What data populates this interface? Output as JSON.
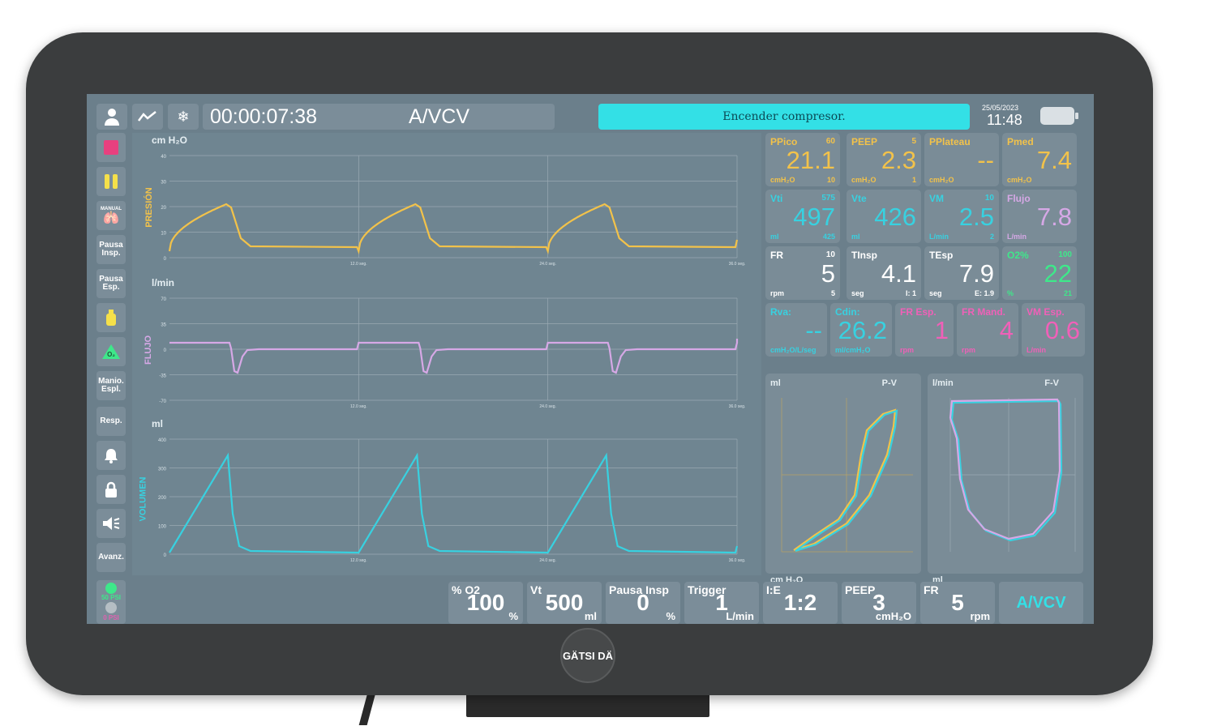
{
  "header": {
    "timer": "00:00:07:38",
    "mode": "A/VCV",
    "banner": "Encender compresor.",
    "date": "25/05/2023",
    "time": "11:48"
  },
  "sidebar": {
    "items": [
      {
        "name": "stop",
        "label": ""
      },
      {
        "name": "pause",
        "label": ""
      },
      {
        "name": "manual",
        "label": "MANUAL"
      },
      {
        "name": "pausa-insp",
        "label": "Pausa Insp."
      },
      {
        "name": "pausa-esp",
        "label": "Pausa Esp."
      },
      {
        "name": "nebulizer",
        "label": ""
      },
      {
        "name": "o2",
        "label": ""
      },
      {
        "name": "manio-espl",
        "label": "Manio. Espl."
      },
      {
        "name": "resp",
        "label": "Resp."
      },
      {
        "name": "alarm",
        "label": ""
      },
      {
        "name": "lock",
        "label": ""
      },
      {
        "name": "mute",
        "label": ""
      },
      {
        "name": "avanz",
        "label": "Avanz."
      }
    ],
    "gas": {
      "green": "50 PSI",
      "grey": "0 PSI"
    }
  },
  "waves": {
    "pressure": {
      "unit": "cm H₂O",
      "label": "PRESIÓN",
      "yticks": [
        "40",
        "30",
        "20",
        "10",
        "0"
      ],
      "xticks": [
        "12.0 seg.",
        "24.0 seg.",
        "36.0 seg."
      ],
      "color": "#f2c24a"
    },
    "flow": {
      "unit": "l/min",
      "label": "FLUJO",
      "yticks": [
        "70",
        "35",
        "0",
        "-35",
        "-70"
      ],
      "xticks": [
        "12.0 seg.",
        "24.0 seg.",
        "36.0 seg."
      ],
      "color": "#d6a8e6"
    },
    "volume": {
      "unit": "ml",
      "label": "VOLUMEN",
      "yticks": [
        "400",
        "300",
        "200",
        "100",
        "0"
      ],
      "xticks": [
        "12.0 seg.",
        "24.0 seg.",
        "36.0 seg."
      ],
      "color": "#38d1e0"
    }
  },
  "metrics": [
    {
      "label": "PPico",
      "value": "21.1",
      "unit": "cmH₂O",
      "hi": "60",
      "lo": "10",
      "color": "#f2c24a"
    },
    {
      "label": "PEEP",
      "value": "2.3",
      "unit": "cmH₂O",
      "hi": "5",
      "lo": "1",
      "color": "#f2c24a"
    },
    {
      "label": "PPlateau",
      "value": "--",
      "unit": "cmH₂O",
      "hi": "",
      "lo": "",
      "color": "#f2c24a"
    },
    {
      "label": "Pmed",
      "value": "7.4",
      "unit": "cmH₂O",
      "hi": "",
      "lo": "",
      "color": "#f2c24a"
    },
    {
      "label": "Vti",
      "value": "497",
      "unit": "ml",
      "hi": "575",
      "lo": "425",
      "color": "#38d1e0"
    },
    {
      "label": "Vte",
      "value": "426",
      "unit": "ml",
      "hi": "",
      "lo": "",
      "color": "#38d1e0"
    },
    {
      "label": "VM",
      "value": "2.5",
      "unit": "L/min",
      "hi": "10",
      "lo": "2",
      "color": "#38d1e0"
    },
    {
      "label": "Flujo",
      "value": "7.8",
      "unit": "L/min",
      "hi": "",
      "lo": "",
      "color": "#d6a8e6"
    },
    {
      "label": "FR",
      "value": "5",
      "unit": "rpm",
      "hi": "10",
      "lo": "5",
      "color": "#ffffff"
    },
    {
      "label": "TInsp",
      "value": "4.1",
      "unit": "seg",
      "hi": "",
      "lo": "I: 1",
      "color": "#ffffff"
    },
    {
      "label": "TEsp",
      "value": "7.9",
      "unit": "seg",
      "hi": "",
      "lo": "E: 1.9",
      "color": "#ffffff"
    },
    {
      "label": "O2%",
      "value": "22",
      "unit": "%",
      "hi": "100",
      "lo": "21",
      "color": "#3ee88a"
    },
    {
      "label": "Rva:",
      "value": "--",
      "unit": "cmH₂O/L/seg",
      "hi": "",
      "lo": "",
      "color": "#38d1e0"
    },
    {
      "label": "Cdin:",
      "value": "26.2",
      "unit": "ml/cmH₂O",
      "hi": "",
      "lo": "",
      "color": "#38d1e0"
    },
    {
      "label": "FR Esp.",
      "value": "1",
      "unit": "rpm",
      "hi": "",
      "lo": "",
      "color": "#f060b8"
    },
    {
      "label": "FR Mand.",
      "value": "4",
      "unit": "rpm",
      "hi": "",
      "lo": "",
      "color": "#f060b8"
    },
    {
      "label": "VM Esp.",
      "value": "0.6",
      "unit": "L/min",
      "hi": "",
      "lo": "",
      "color": "#f060b8"
    }
  ],
  "loops": {
    "pv": {
      "ylabel": "ml",
      "title": "P-V",
      "xlabel": "cm H₂O"
    },
    "fv": {
      "ylabel": "l/min",
      "title": "F-V",
      "xlabel": "ml"
    }
  },
  "settings": [
    {
      "label": "% O2",
      "value": "100",
      "unit": "%"
    },
    {
      "label": "Vt",
      "value": "500",
      "unit": "ml"
    },
    {
      "label": "Pausa Insp",
      "value": "0",
      "unit": "%"
    },
    {
      "label": "Trigger",
      "value": "1",
      "unit": "L/min"
    },
    {
      "label": "I:E",
      "value": "1:2",
      "unit": ""
    },
    {
      "label": "PEEP",
      "value": "3",
      "unit": "cmH₂O"
    },
    {
      "label": "FR",
      "value": "5",
      "unit": "rpm"
    }
  ],
  "mode_button": "A/VCV",
  "brand": "GÄTSI DÄ"
}
